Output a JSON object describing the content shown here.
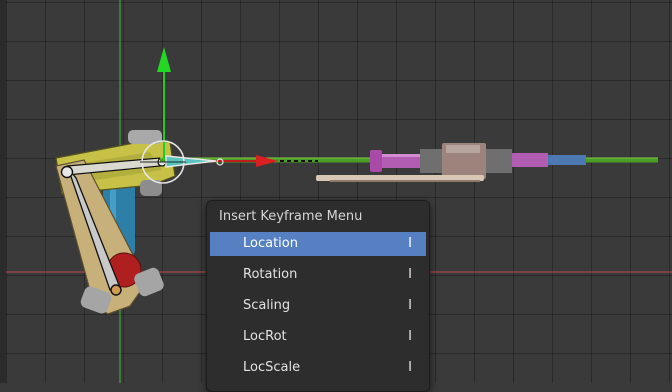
{
  "viewport": {
    "colors": {
      "background": "#3a3a3a",
      "axis_x": "#b84a4a",
      "axis_y": "#4aa84a",
      "selection": "#e0e0e0"
    }
  },
  "keyframe_menu": {
    "title": "Insert Keyframe Menu",
    "items": [
      {
        "label": "Location",
        "shortcut": "I",
        "active": true
      },
      {
        "label": "Rotation",
        "shortcut": "I",
        "active": false
      },
      {
        "label": "Scaling",
        "shortcut": "I",
        "active": false
      },
      {
        "label": "LocRot",
        "shortcut": "I",
        "active": false
      },
      {
        "label": "LocScale",
        "shortcut": "I",
        "active": false
      }
    ],
    "highlight_color": "#5680c2"
  }
}
